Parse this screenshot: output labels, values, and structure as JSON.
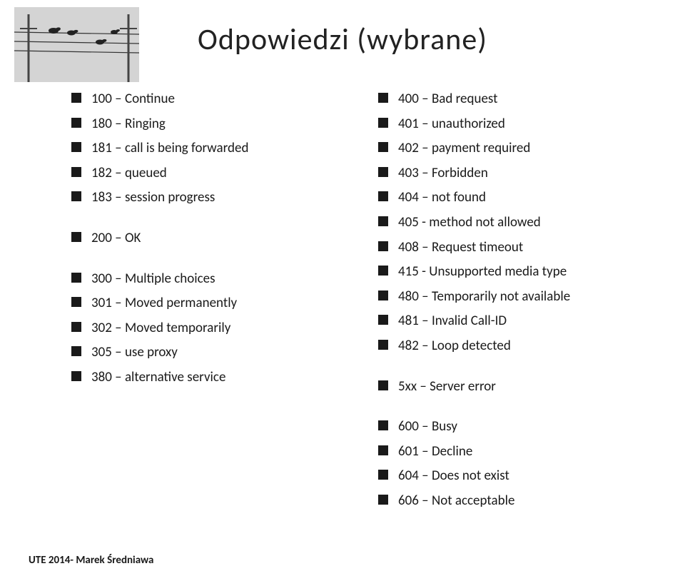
{
  "title": "Odpowiedzi (wybrane)",
  "footer": "UTE 2014- Marek Średniawa",
  "left_column": {
    "items_1xx": [
      "100 – Continue",
      "180 – Ringing",
      "181 – call is being forwarded",
      "182 – queued",
      "183 – session progress"
    ],
    "items_2xx": [
      "200 – OK"
    ],
    "items_3xx": [
      "300 – Multiple choices",
      "301 – Moved permanently",
      "302 – Moved temporarily",
      "305 – use proxy",
      "380 – alternative service"
    ]
  },
  "right_column": {
    "items_4xx": [
      "400 – Bad request",
      "401 – unauthorized",
      "402 – payment required",
      "403 – Forbidden",
      "404 – not found",
      "405 - method not allowed",
      "408 – Request timeout",
      "415 - Unsupported media type",
      "480 – Temporarily not available",
      "481 – Invalid Call-ID",
      "482 – Loop detected"
    ],
    "items_5xx": [
      "5xx – Server error"
    ],
    "items_6xx": [
      "600 – Busy",
      "601 – Decline",
      "604 – Does not exist",
      "606 – Not acceptable"
    ]
  }
}
